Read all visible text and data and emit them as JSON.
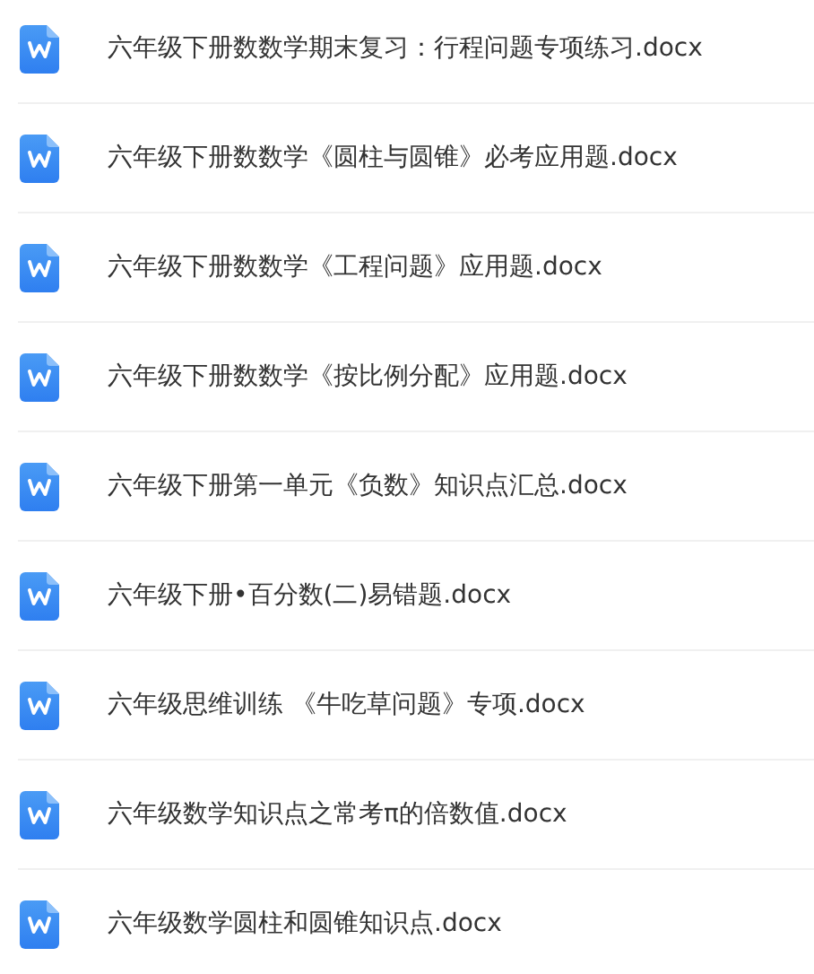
{
  "files": [
    {
      "name": "六年级下册数数学期末复习：行程问题专项练习.docx"
    },
    {
      "name": "六年级下册数数学《圆柱与圆锥》必考应用题.docx"
    },
    {
      "name": "六年级下册数数学《工程问题》应用题.docx"
    },
    {
      "name": "六年级下册数数学《按比例分配》应用题.docx"
    },
    {
      "name": "六年级下册第一单元《负数》知识点汇总.docx"
    },
    {
      "name": "六年级下册•百分数(二)易错题.docx"
    },
    {
      "name": "六年级思维训练 《牛吃草问题》专项.docx"
    },
    {
      "name": "六年级数学知识点之常考π的倍数值.docx"
    },
    {
      "name": "六年级数学圆柱和圆锥知识点.docx"
    }
  ]
}
